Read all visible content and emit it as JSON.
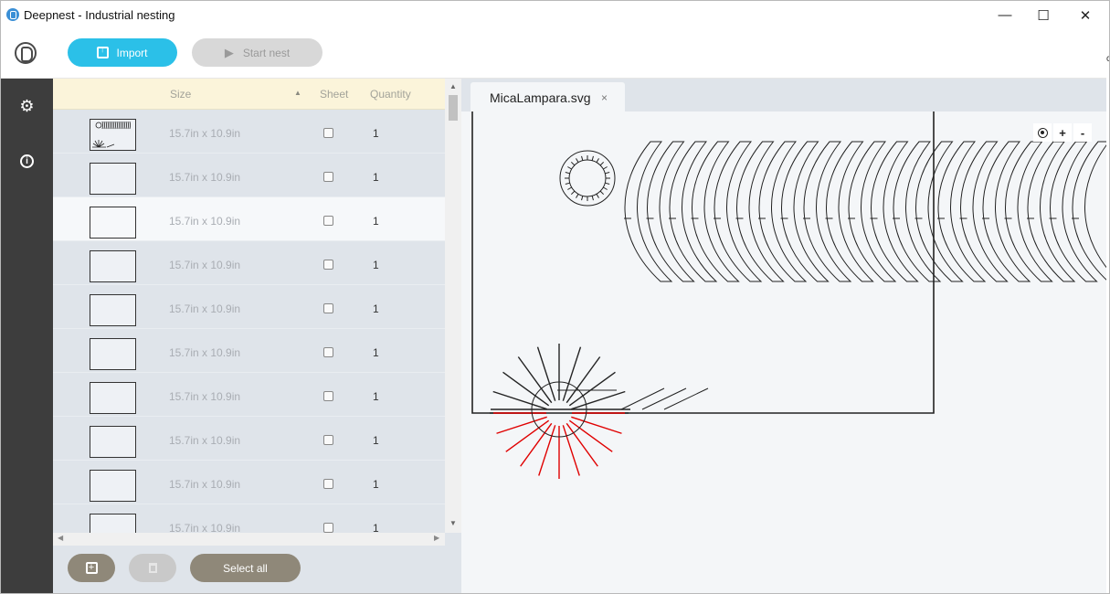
{
  "window": {
    "title": "Deepnest - Industrial nesting",
    "minimize": "—",
    "maximize": "☐",
    "close": "✕",
    "edge_char": "c"
  },
  "toolbar": {
    "import_label": "Import",
    "start_label": "Start nest"
  },
  "rail": {
    "settings_icon": "⚙",
    "info_icon": "i"
  },
  "parts_table": {
    "columns": {
      "size": "Size",
      "sort_indicator": "▲",
      "sheet": "Sheet",
      "quantity": "Quantity"
    },
    "rows": [
      {
        "size": "15.7in x 10.9in",
        "quantity": "1",
        "sheet": false
      },
      {
        "size": "15.7in x 10.9in",
        "quantity": "1",
        "sheet": false
      },
      {
        "size": "15.7in x 10.9in",
        "quantity": "1",
        "sheet": false
      },
      {
        "size": "15.7in x 10.9in",
        "quantity": "1",
        "sheet": false
      },
      {
        "size": "15.7in x 10.9in",
        "quantity": "1",
        "sheet": false
      },
      {
        "size": "15.7in x 10.9in",
        "quantity": "1",
        "sheet": false
      },
      {
        "size": "15.7in x 10.9in",
        "quantity": "1",
        "sheet": false
      },
      {
        "size": "15.7in x 10.9in",
        "quantity": "1",
        "sheet": false
      },
      {
        "size": "15.7in x 10.9in",
        "quantity": "1",
        "sheet": false
      },
      {
        "size": "15.7in x 10.9in",
        "quantity": "1",
        "sheet": false
      }
    ],
    "selected_row": 2
  },
  "panel_footer": {
    "add_icon": "+",
    "select_all_label": "Select all"
  },
  "tabs": [
    {
      "label": "MicaLampara.svg",
      "close": "×"
    }
  ],
  "zoom": {
    "in": "+",
    "out": "-"
  },
  "colors": {
    "accent": "#2bc0e8",
    "rail": "#3d3d3d",
    "panel": "#dfe4ea",
    "header": "#fbf4da",
    "footer_button": "#8f8879",
    "cut_highlight": "#e00000"
  }
}
